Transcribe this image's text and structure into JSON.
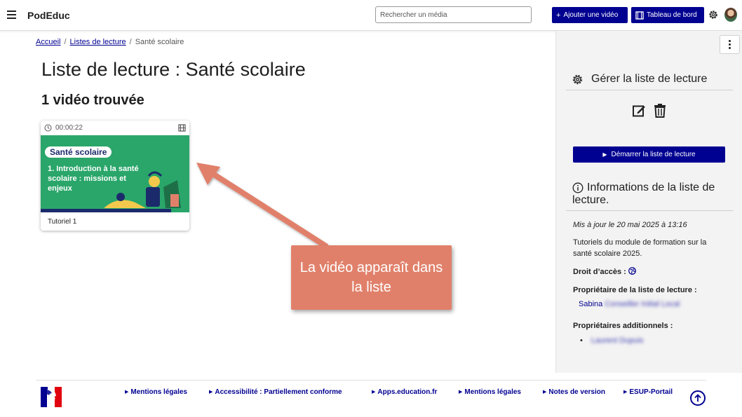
{
  "header": {
    "brand": "PodEduc",
    "search_placeholder": "Rechercher un média",
    "add_video": "Ajouter une vidéo",
    "dashboard": "Tableau de bord"
  },
  "breadcrumb": {
    "home": "Accueil",
    "lists": "Listes de lecture",
    "current": "Santé scolaire"
  },
  "main": {
    "title": "Liste de lecture : Santé scolaire",
    "count": "1 vidéo trouvée"
  },
  "video_card": {
    "duration": "00:00:22",
    "thumb_tag": "Santé scolaire",
    "thumb_title": "1. Introduction à la santé scolaire : missions et enjeux",
    "caption": "Tutoriel 1"
  },
  "callout": {
    "text": "La vidéo apparaît dans la liste"
  },
  "sidebar": {
    "manage_title": "Gérer la liste de lecture",
    "start_button": "Démarrer la liste de lecture",
    "info_title": "Informations de la liste de lecture.",
    "updated": "Mis à jour le 20 mai 2025 à 13:16",
    "description": "Tutoriels du module de formation sur la santé scolaire 2025.",
    "access_label": "Droit d’accès :",
    "owner_label": "Propriétaire de la liste de lecture :",
    "owner_first": "Sabina",
    "owner_rest": "Conseiller Initial Local",
    "additional_label": "Propriétaires additionnels :",
    "additional_owner": "Laurent Dupuis"
  },
  "footer": {
    "links": [
      "Mentions légales",
      "Accessibilité : Partiellement conforme",
      "Apps.education.fr",
      "Mentions légales",
      "Notes de version",
      "ESUP-Portail"
    ]
  },
  "colors": {
    "primary": "#000091",
    "callout": "#e1806a",
    "thumb_green": "#2aa66a",
    "sidebar_bg": "#f3f3f3"
  }
}
